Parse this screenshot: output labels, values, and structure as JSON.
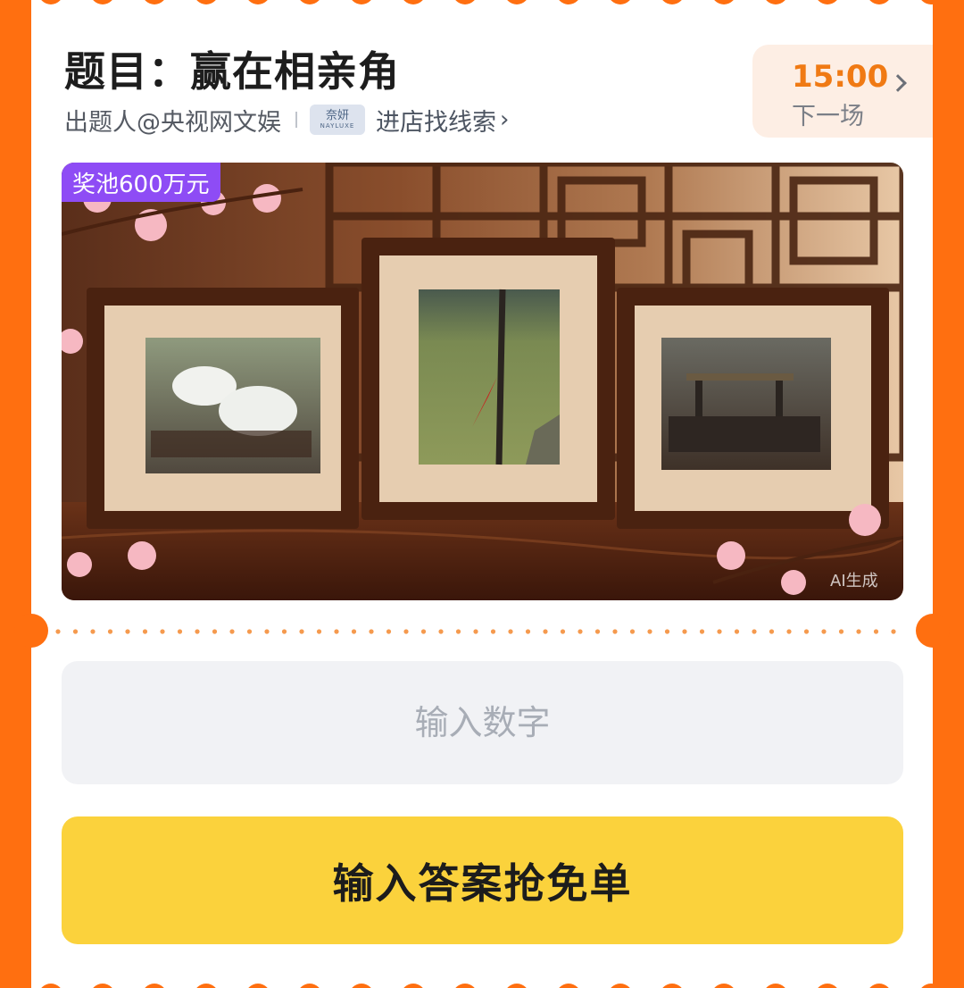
{
  "quiz": {
    "title": "题目：赢在相亲角",
    "poster": "出题人@央视网文娱",
    "brand_logo_cn": "奈妍",
    "brand_logo_en": "NAYLUXE",
    "store_link": "进店找线索"
  },
  "next_session": {
    "time": "15:00",
    "label": "下一场"
  },
  "hero": {
    "prize_badge": "奖池600万元",
    "ai_mark": "AI生成"
  },
  "answer": {
    "placeholder": "输入数字",
    "submit_label": "输入答案抢免单"
  },
  "colors": {
    "background": "#ff6f10",
    "accent_orange": "#f07a14",
    "badge_purple": "#8e4cf5",
    "button_yellow": "#fbd23c"
  },
  "icons": {
    "store_chevron": "chevron-right-icon",
    "next_chevron": "chevron-right-icon"
  }
}
